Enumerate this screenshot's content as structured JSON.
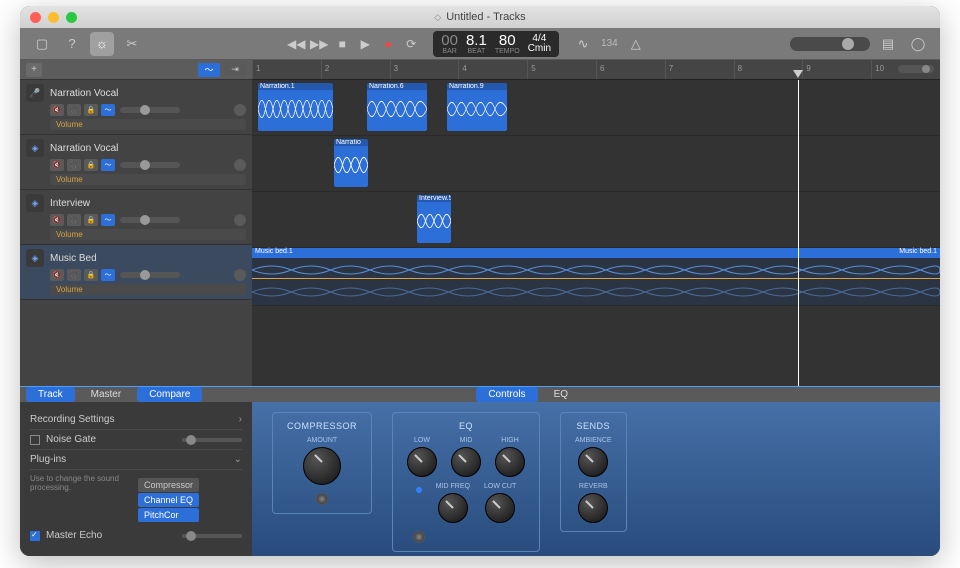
{
  "window": {
    "title": "Untitled - Tracks"
  },
  "toolbar": {
    "counter": "134",
    "lcd": {
      "bar_label": "BAR",
      "bar": "00",
      "beat_label": "BEAT",
      "beat": "8.1",
      "tempo_label": "TEMPO",
      "tempo": "80",
      "sig": "4/4",
      "key": "Cmin"
    }
  },
  "ruler": [
    "1",
    "2",
    "3",
    "4",
    "5",
    "6",
    "7",
    "8",
    "9",
    "10"
  ],
  "tracks": [
    {
      "name": "Narration Vocal",
      "vol": "Volume"
    },
    {
      "name": "Narration Vocal",
      "vol": "Volume"
    },
    {
      "name": "Interview",
      "vol": "Volume"
    },
    {
      "name": "Music Bed",
      "vol": "Volume"
    }
  ],
  "clips": {
    "n1": "Narration.1",
    "n2": "Narration.6",
    "n3": "Narration.9",
    "nb": "Narratio",
    "iv": "Interview.5",
    "music_left": "Music bed.1",
    "music_right": "Music bed.1"
  },
  "editor": {
    "tabs": {
      "track": "Track",
      "master": "Master",
      "compare": "Compare",
      "controls": "Controls",
      "eq": "EQ"
    },
    "rec": "Recording Settings",
    "noise": "Noise Gate",
    "plugins": "Plug-ins",
    "desc": "Use to change the sound processing.",
    "pluglist": [
      "Compressor",
      "Channel EQ",
      "PitchCor"
    ],
    "mecho": "Master Echo",
    "fx": {
      "comp": "COMPRESSOR",
      "amount": "AMOUNT",
      "eq": "EQ",
      "low": "LOW",
      "mid": "MID",
      "high": "HIGH",
      "midfreq": "MID FREQ",
      "lowcut": "LOW CUT",
      "sends": "SENDS",
      "amb": "AMBIENCE",
      "rev": "REVERB"
    }
  }
}
